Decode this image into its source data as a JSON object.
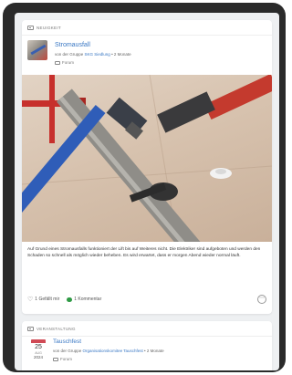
{
  "news_card": {
    "type_label": "NEUIGKEIT",
    "title": "Stromausfall",
    "meta_prefix": "von der Gruppe",
    "group_name": "SKG Siedlung",
    "meta_suffix": "• 2 Monate",
    "forum_label": "Forum",
    "body": "Auf Grund eines Stromausfalls funktioniert der Lift bis auf Weiteres nicht. Die Elektriker sind aufgeboten und werden den Schaden so schnell als möglich wieder beheben. Es wird erwartet, dass er morgen Abend wieder normal läuft.",
    "like_label": "1 Gefällt mir",
    "comment_label": "1 Kommentar",
    "more_label": "⋯"
  },
  "event_card": {
    "type_label": "VERANSTALTUNG",
    "date_day": "25",
    "date_month": "AUG",
    "date_year": "2024",
    "title": "Tauschfest",
    "meta_prefix": "von der Gruppe",
    "group_name": "Organisationskomitee Tauschfest",
    "meta_suffix": "• 2 Monate",
    "forum_label": "Forum"
  },
  "colors": {
    "link": "#3a78c4",
    "comment_bubble": "#2f9a45",
    "date_accent": "#d04a55"
  }
}
